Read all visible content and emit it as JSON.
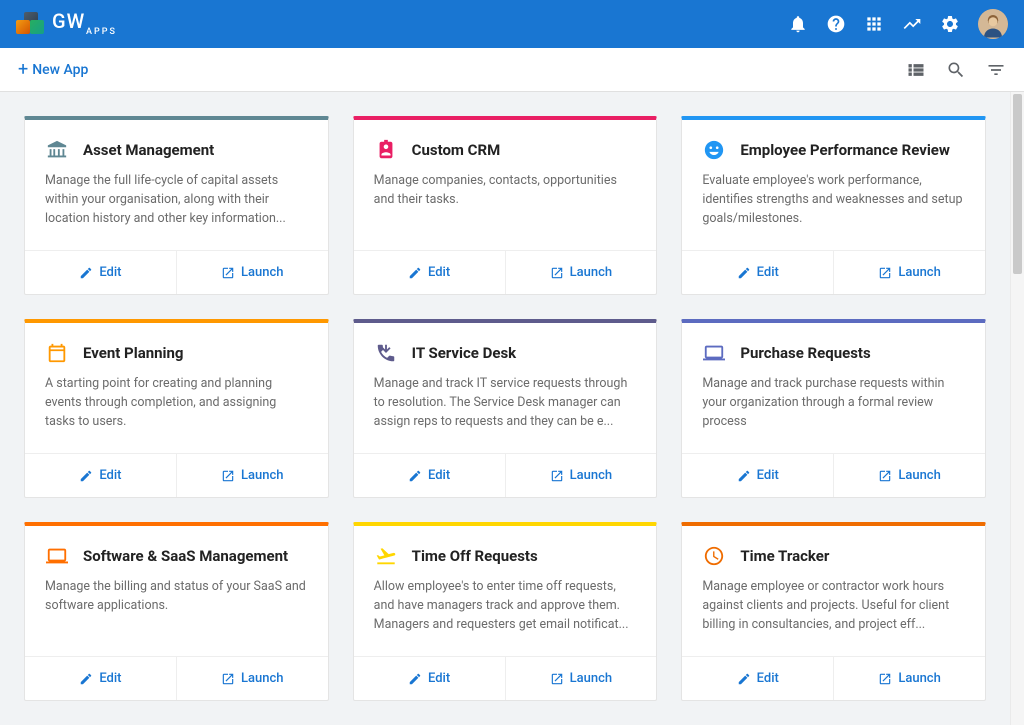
{
  "brand": {
    "name": "GW",
    "sub": "APPS"
  },
  "subbar": {
    "new_app": "New App"
  },
  "actions": {
    "edit": "Edit",
    "launch": "Launch"
  },
  "cards": [
    {
      "title": "Asset Management",
      "desc": "Manage the full life-cycle of capital assets within your organisation, along with their location history and other key information...",
      "color": "#5f8793",
      "icon": "bank",
      "iconColor": "#5f8793"
    },
    {
      "title": "Custom CRM",
      "desc": "Manage companies, contacts, opportunities and their tasks.",
      "color": "#e91e63",
      "icon": "id-badge",
      "iconColor": "#e91e63"
    },
    {
      "title": "Employee Performance Review",
      "desc": "Evaluate employee's work performance, identifies strengths and weaknesses and setup goals/milestones.",
      "color": "#2196f3",
      "icon": "smile",
      "iconColor": "#2196f3"
    },
    {
      "title": "Event Planning",
      "desc": "A starting point for creating and planning events through completion, and assigning tasks to users.",
      "color": "#ff9800",
      "icon": "calendar",
      "iconColor": "#ff9800"
    },
    {
      "title": "IT Service Desk",
      "desc": "Manage and track IT service requests through to resolution. The Service Desk manager can assign reps to requests and they can be e...",
      "color": "#5e5b8c",
      "icon": "phone",
      "iconColor": "#5e5b8c"
    },
    {
      "title": "Purchase Requests",
      "desc": "Manage and track purchase requests within your organization through a formal review process",
      "color": "#5c6bc0",
      "icon": "laptop",
      "iconColor": "#5c6bc0"
    },
    {
      "title": "Software & SaaS Management",
      "desc": "Manage the billing and status of your SaaS and software applications.",
      "color": "#ff6f00",
      "icon": "laptop",
      "iconColor": "#ff6f00"
    },
    {
      "title": "Time Off Requests",
      "desc": "Allow employee's to enter time off requests, and have managers track and approve them. Managers and requesters get email notificat...",
      "color": "#ffd600",
      "icon": "plane",
      "iconColor": "#ffd600"
    },
    {
      "title": "Time Tracker",
      "desc": "Manage employee or contractor work hours against clients and projects. Useful for client billing in consultancies, and project eff...",
      "color": "#ef6c00",
      "icon": "clock",
      "iconColor": "#ef6c00"
    }
  ]
}
